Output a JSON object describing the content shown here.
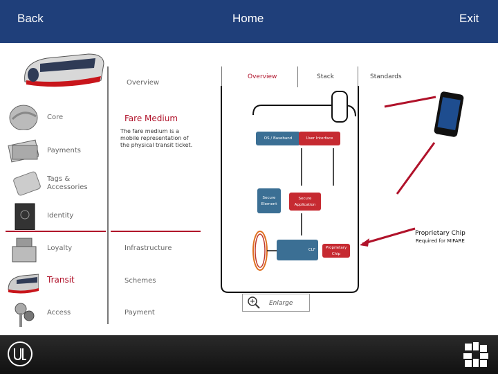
{
  "header": {
    "back_label": "Back",
    "home_label": "Home",
    "exit_label": "Exit"
  },
  "sidebar": {
    "items": [
      {
        "label": "Core",
        "icon": "helmet-icon"
      },
      {
        "label": "Payments",
        "icon": "cash-icon"
      },
      {
        "label": "Tags & Accessories",
        "icon": "card-tag-icon"
      },
      {
        "label": "Identity",
        "icon": "passport-icon"
      },
      {
        "label": "Loyalty",
        "icon": "cash-register-icon"
      },
      {
        "label": "Transit",
        "icon": "train-icon"
      },
      {
        "label": "Access",
        "icon": "keys-icon"
      }
    ]
  },
  "subnav": {
    "overview_label": "Overview",
    "section_title": "Fare Medium",
    "description": "The fare medium is a mobile representation of the physical transit ticket.",
    "items": [
      "Infrastructure",
      "Schemes",
      "Payment"
    ]
  },
  "diagram": {
    "tabs": [
      "Overview",
      "Stack",
      "Standards"
    ],
    "blocks": {
      "os": "OS / Baseband",
      "ui": "User Interface",
      "secure_element": "Secure Element",
      "secure_app": "Secure Application",
      "clf": "CLF",
      "prop_chip": "Proprietary Chip"
    },
    "callout_title": "Proprietary Chip",
    "callout_sub": "Required for MIFARE",
    "enlarge_label": "Enlarge"
  },
  "colors": {
    "header": "#1f3f7a",
    "accent_red": "#b0122a",
    "block_blue": "#3b6f94",
    "block_red": "#c62a31"
  }
}
